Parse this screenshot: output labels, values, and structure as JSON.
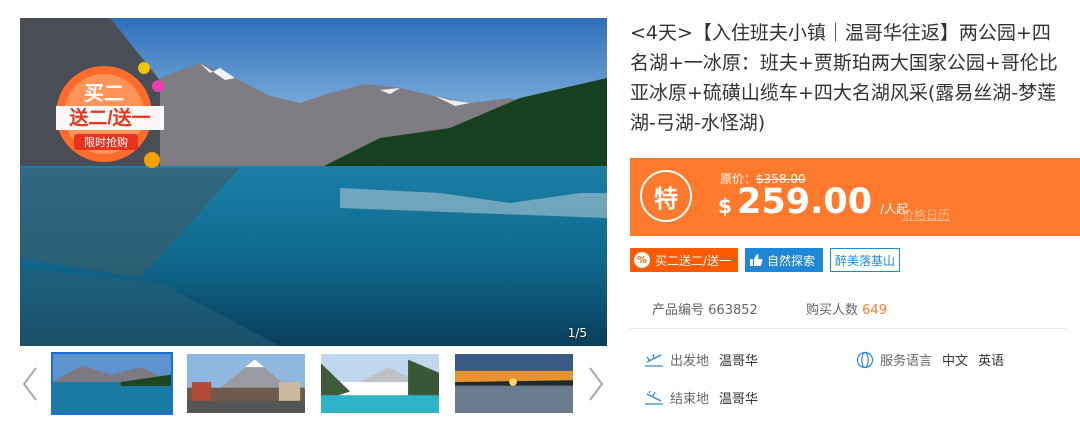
{
  "gallery": {
    "counter": "1/5",
    "badge": {
      "line1": "买二",
      "line2": "送二/送一",
      "ribbon": "限时抢购"
    }
  },
  "product": {
    "title": "<4天>【入住班夫小镇｜温哥华往返】两公园+四名湖+一冰原：班夫+贾斯珀两大国家公园+哥伦比亚冰原+硫磺山缆车+四大名湖风采(露易丝湖-梦莲湖-弓湖-水怪湖)"
  },
  "price": {
    "special_label": "特",
    "original_label": "原价：",
    "original_value": "$358.00",
    "currency": "$",
    "amount": "259.00",
    "unit": "/人起",
    "calendar_link": "价格日历"
  },
  "tags": {
    "promo": "买二送二/送一",
    "promo_icon": "%",
    "nature": "自然探索",
    "scenic": "醉美落基山"
  },
  "meta": {
    "product_id_label": "产品编号",
    "product_id": "663852",
    "buyers_label": "购买人数",
    "buyers": "649"
  },
  "info": {
    "departure_label": "出发地",
    "departure": "温哥华",
    "end_label": "结束地",
    "end": "温哥华",
    "language_label": "服务语言",
    "languages": [
      "中文",
      "英语"
    ]
  },
  "colors": {
    "accent": "#ff7a2c",
    "blue": "#1f87d8",
    "promo": "#ff5a00"
  }
}
